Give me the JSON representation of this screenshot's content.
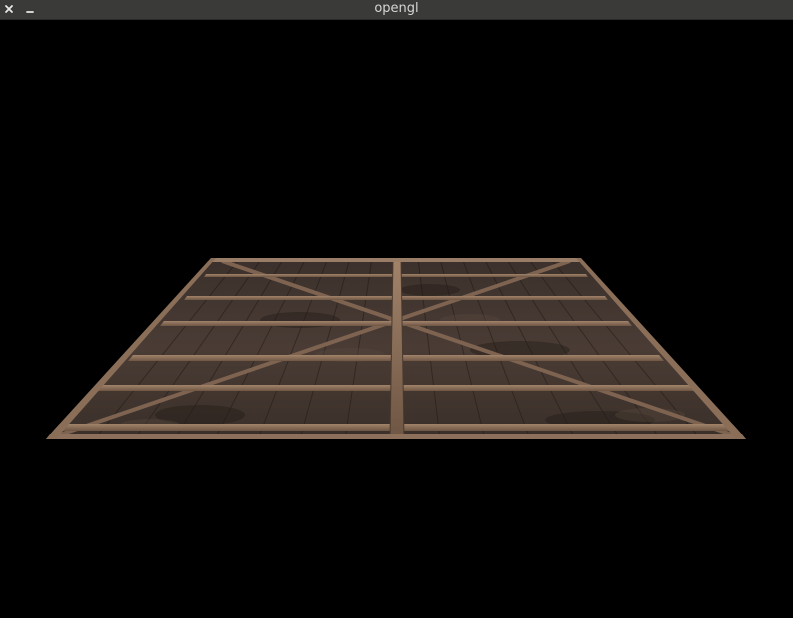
{
  "window": {
    "title": "opengl",
    "background_color": "#000000",
    "titlebar_color": "#3a3a38",
    "title_color": "#d6d6d3"
  },
  "controls": {
    "close_icon": "close-icon",
    "minimize_icon": "minimize-icon"
  },
  "scene": {
    "object": "wooden-crate-face-floor",
    "texture_color_dark": "#2e2520",
    "texture_color_mid": "#4a3b33",
    "plank_color": "#8a6e58"
  }
}
